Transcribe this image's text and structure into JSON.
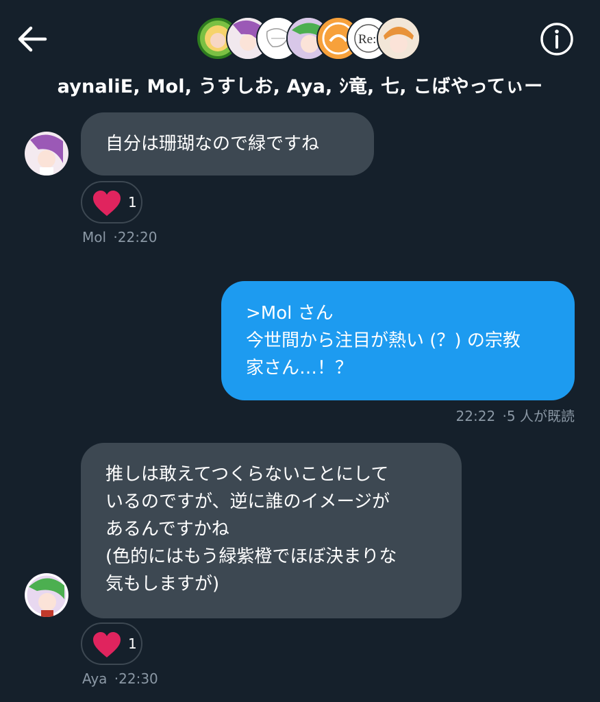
{
  "header": {
    "group_names": "aynaliE, Mol, うすしお, Aya, ｼ竜, 七, こばやってぃー",
    "back_icon": "arrow-left-icon",
    "info_icon": "info-icon",
    "member_avatars": [
      "green-portrait",
      "purple-portrait",
      "white-sketch",
      "green-hair-portrait",
      "orange-emblem",
      "re-logo",
      "orange-hair-portrait"
    ],
    "re_logo_text": "Re:"
  },
  "messages": [
    {
      "direction": "incoming",
      "lines": [
        "自分は珊瑚なので緑ですね"
      ],
      "reaction": {
        "icon": "heart-icon",
        "count": "1"
      },
      "sender": "Mol",
      "time": "·22:20"
    },
    {
      "direction": "outgoing",
      "lines": [
        ">Mol さん",
        "今世間から注目が熱い (？) の宗教",
        "家さん…！？"
      ],
      "time": "22:22",
      "read_status": "·5 人が既読"
    },
    {
      "direction": "incoming",
      "lines": [
        "推しは敢えてつくらないことにして",
        "いるのですが、逆に誰のイメージが",
        "あるんですかね",
        "(色的にはもう緑紫橙でほぼ決まりな",
        "気もしますが)"
      ],
      "reaction": {
        "icon": "heart-icon",
        "count": "1"
      },
      "sender": "Aya",
      "time": "·22:30"
    }
  ],
  "colors": {
    "background": "#15202b",
    "incoming_bubble": "#3d4852",
    "outgoing_bubble": "#1d9bf0",
    "heart": "#f91880",
    "meta_text": "#8b98a5"
  }
}
